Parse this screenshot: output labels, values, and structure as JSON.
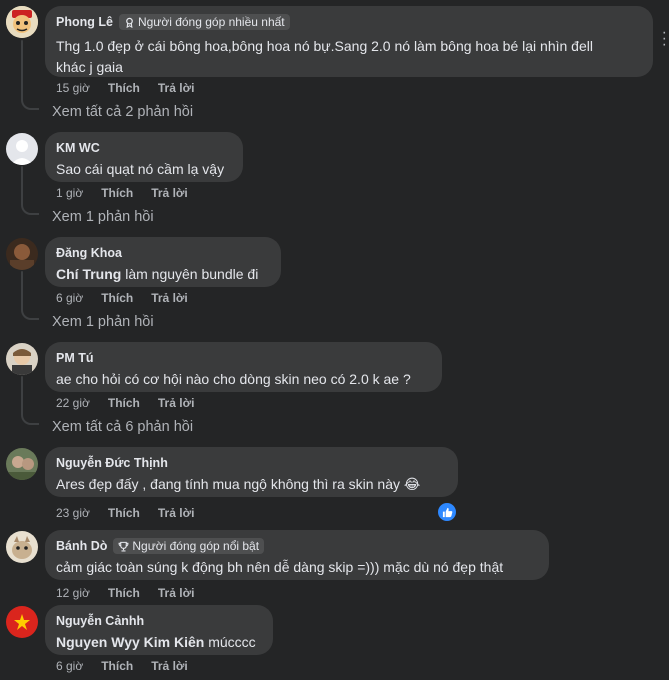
{
  "comments": [
    {
      "name": "Phong Lê",
      "badge": "Người đóng góp nhiều nhất",
      "text_lines": [
        "Thg 1.0 đẹp ở cái bông hoa,bông hoa nó bự.Sang 2.0 nó làm bông hoa bé lại nhìn đell",
        "khác j gaia"
      ],
      "time": "15 giờ",
      "like": "Thích",
      "reply": "Trả lời",
      "view_replies": "Xem tất cả 2 phản hồi"
    },
    {
      "name": "KM WC",
      "text": "Sao cái quạt nó cầm lạ vậy",
      "time": "1 giờ",
      "like": "Thích",
      "reply": "Trả lời",
      "view_replies": "Xem 1 phản hồi"
    },
    {
      "name": "Đăng Khoa",
      "mention": "Chí Trung",
      "text": " làm nguyên bundle đi",
      "time": "6 giờ",
      "like": "Thích",
      "reply": "Trả lời",
      "view_replies": "Xem 1 phản hồi"
    },
    {
      "name": "PM Tú",
      "text": "ae cho hỏi có cơ hội nào cho dòng skin neo có 2.0 k ae ?",
      "time": "22 giờ",
      "like": "Thích",
      "reply": "Trả lời",
      "view_replies": "Xem tất cả 6 phản hồi"
    },
    {
      "name": "Nguyễn Đức Thịnh",
      "text": "Ares đẹp đấy , đang tính mua ngộ không thì ra skin này 😂",
      "time": "23 giờ",
      "like": "Thích",
      "reply": "Trả lời"
    },
    {
      "name": "Bánh Dò",
      "badge": "Người đóng góp nổi bật",
      "text": "cảm giác toàn súng k động bh nên dễ dàng skip =))) mặc dù nó đẹp thật",
      "time": "12 giờ",
      "like": "Thích",
      "reply": "Trả lời"
    },
    {
      "name": "Nguyễn Cảnhh",
      "mention": "Nguyen Wyy Kim Kiên",
      "text": " múcccc",
      "time": "6 giờ",
      "like": "Thích",
      "reply": "Trả lời"
    }
  ],
  "colors": {
    "background": "#242526",
    "bubble": "#3a3b3c",
    "text": "#e4e6eb",
    "secondary": "#b0b3b8",
    "like_blue": "#2d88ff"
  }
}
